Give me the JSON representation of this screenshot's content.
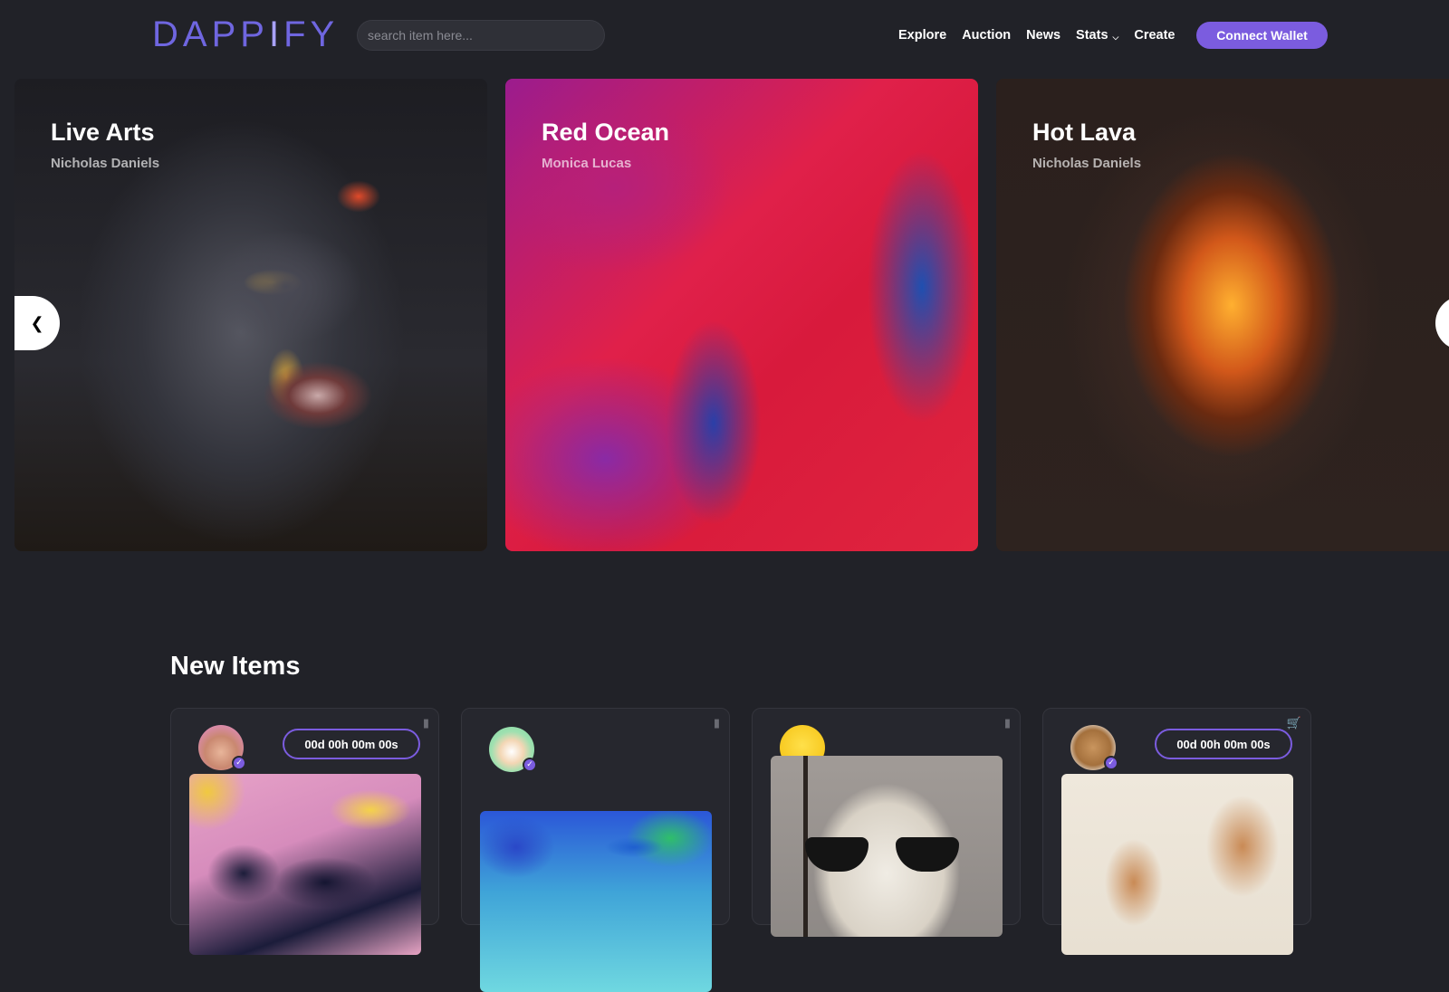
{
  "header": {
    "logo_main": "DAPP",
    "logo_accent": "I",
    "logo_tail": "FY",
    "search_placeholder": "search item here...",
    "nav": [
      "Explore",
      "Auction",
      "News",
      "Stats",
      "Create"
    ],
    "connect_label": "Connect Wallet"
  },
  "carousel": {
    "slides": [
      {
        "title": "Live Arts",
        "author": "Nicholas Daniels"
      },
      {
        "title": "Red Ocean",
        "author": "Monica Lucas"
      },
      {
        "title": "Hot Lava",
        "author": "Nicholas Daniels"
      }
    ],
    "prev_icon": "chevron-left-icon",
    "next_icon": "chevron-right-icon"
  },
  "new_items": {
    "title": "New Items",
    "cards": [
      {
        "timer": "00d 00h 00m 00s",
        "icon": "bookmark-icon"
      },
      {
        "timer": "",
        "icon": "bookmark-icon"
      },
      {
        "timer": "",
        "icon": "bookmark-icon"
      },
      {
        "timer": "00d 00h 00m 00s",
        "icon": "shopping-basket-icon"
      }
    ]
  },
  "colors": {
    "background": "#212228",
    "accent": "#7b5cdf",
    "logo": "#6f66e0"
  }
}
